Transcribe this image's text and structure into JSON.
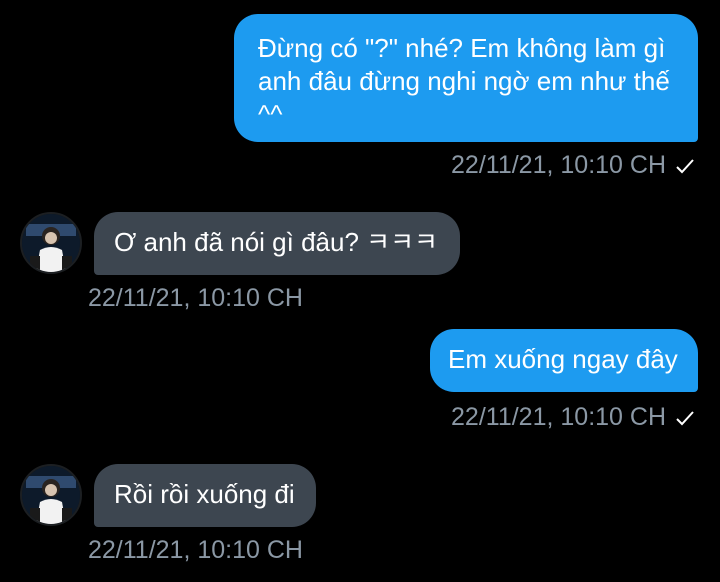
{
  "colors": {
    "background": "#000000",
    "outgoing_bubble": "#1d9bf0",
    "incoming_bubble": "#3d4650",
    "timestamp": "#8b98a5"
  },
  "messages": [
    {
      "direction": "outgoing",
      "lines": [
        "Đừng có \"?\" nhé? Em không làm gì",
        "anh đâu đừng nghi ngờ em như thế",
        "^^"
      ],
      "timestamp": "22/11/21, 10:10 CH",
      "status_icon": "check-icon"
    },
    {
      "direction": "incoming",
      "lines": [
        "Ơ anh đã nói gì đâu? ㅋㅋㅋ"
      ],
      "timestamp": "22/11/21, 10:10 CH",
      "avatar_icon": "avatar"
    },
    {
      "direction": "outgoing",
      "lines": [
        "Em xuống ngay đây"
      ],
      "timestamp": "22/11/21, 10:10 CH",
      "status_icon": "check-icon"
    },
    {
      "direction": "incoming",
      "lines": [
        "Rồi rồi xuống đi"
      ],
      "timestamp": "22/11/21, 10:10 CH",
      "avatar_icon": "avatar"
    }
  ]
}
